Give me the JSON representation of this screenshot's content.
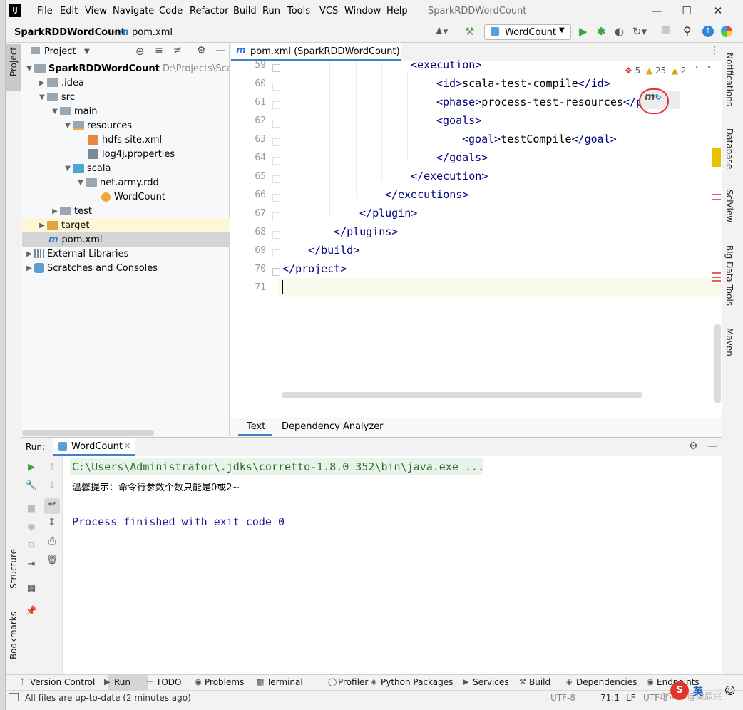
{
  "window": {
    "title": "SparkRDDWordCount",
    "logo": "IJ"
  },
  "menu": [
    "File",
    "Edit",
    "View",
    "Navigate",
    "Code",
    "Refactor",
    "Build",
    "Run",
    "Tools",
    "VCS",
    "Window",
    "Help"
  ],
  "breadcrumb": {
    "project": "SparkRDDWordCount",
    "file": "pom.xml"
  },
  "run_config": {
    "label": "WordCount"
  },
  "left_bar": {
    "project_tab": "Project",
    "structure": "Structure",
    "bookmarks": "Bookmarks"
  },
  "right_bar": {
    "notifications": "Notifications",
    "database": "Database",
    "sciview": "SciView",
    "bigdata": "Big Data Tools",
    "maven": "Maven"
  },
  "project_panel": {
    "title": "Project",
    "tree": [
      {
        "label": "SparkRDDWordCount",
        "extra": "D:\\Projects\\ScalaPro"
      },
      {
        "label": ".idea"
      },
      {
        "label": "src"
      },
      {
        "label": "main"
      },
      {
        "label": "resources"
      },
      {
        "label": "hdfs-site.xml"
      },
      {
        "label": "log4j.properties"
      },
      {
        "label": "scala"
      },
      {
        "label": "net.army.rdd"
      },
      {
        "label": "WordCount"
      },
      {
        "label": "test"
      },
      {
        "label": "target"
      },
      {
        "label": "pom.xml"
      },
      {
        "label": "External Libraries"
      },
      {
        "label": "Scratches and Consoles"
      }
    ]
  },
  "editor": {
    "tab": "pom.xml (SparkRDDWordCount)",
    "inspections": {
      "errors": "5",
      "warnings": "25",
      "weak": "2"
    },
    "lines": [
      {
        "n": "59",
        "open": "<",
        "tag": "execution",
        "close": ">"
      },
      {
        "n": "60"
      },
      {
        "n": "61"
      },
      {
        "n": "62",
        "open": "<",
        "tag": "goals",
        "close": ">"
      },
      {
        "n": "63"
      },
      {
        "n": "64",
        "open": "</",
        "tag": "goals",
        "close": ">"
      },
      {
        "n": "65",
        "open": "</",
        "tag": "execution",
        "close": ">"
      },
      {
        "n": "66",
        "open": "</",
        "tag": "executions",
        "close": ">"
      },
      {
        "n": "67",
        "open": "</",
        "tag": "plugin",
        "close": ">"
      },
      {
        "n": "68",
        "open": "</",
        "tag": "plugins",
        "close": ">"
      },
      {
        "n": "69",
        "open": "</",
        "tag": "build",
        "close": ">"
      },
      {
        "n": "70",
        "open": "</",
        "tag": "project",
        "close": ">"
      },
      {
        "n": "71"
      }
    ],
    "line60": {
      "t1": "<",
      "tag1": "id",
      "t2": ">",
      "text": "scala-test-compile",
      "t3": "</",
      "tag2": "id",
      "t4": ">"
    },
    "line61": {
      "t1": "<",
      "tag1": "phase",
      "t2": ">",
      "text": "process-test-resources",
      "t3": "</p"
    },
    "line63": {
      "t1": "<",
      "tag1": "goal",
      "t2": ">",
      "text": "testCompile",
      "t3": "</",
      "tag2": "goal",
      "t4": ">"
    },
    "bottom_tabs": [
      "Text",
      "Dependency Analyzer"
    ]
  },
  "run_panel": {
    "label": "Run:",
    "tab": "WordCount",
    "output": [
      "C:\\Users\\Administrator\\.jdks\\corretto-1.8.0_352\\bin\\java.exe ...",
      "温馨提示：命令行参数个数只能是0或2~",
      "Process finished with exit code 0"
    ]
  },
  "tool_strip": [
    "Version Control",
    "Run",
    "TODO",
    "Problems",
    "Terminal",
    "Profiler",
    "Python Packages",
    "Services",
    "Build",
    "Dependencies",
    "Endpoints"
  ],
  "status": {
    "message": "All files are up-to-date (2 minutes ago)",
    "encoding": "UTF-8",
    "position": "71:1",
    "line_sep": "LF",
    "encoding2": "UTF-8",
    "watermark": "CSDN @梁辰兴",
    "ime": "英"
  }
}
